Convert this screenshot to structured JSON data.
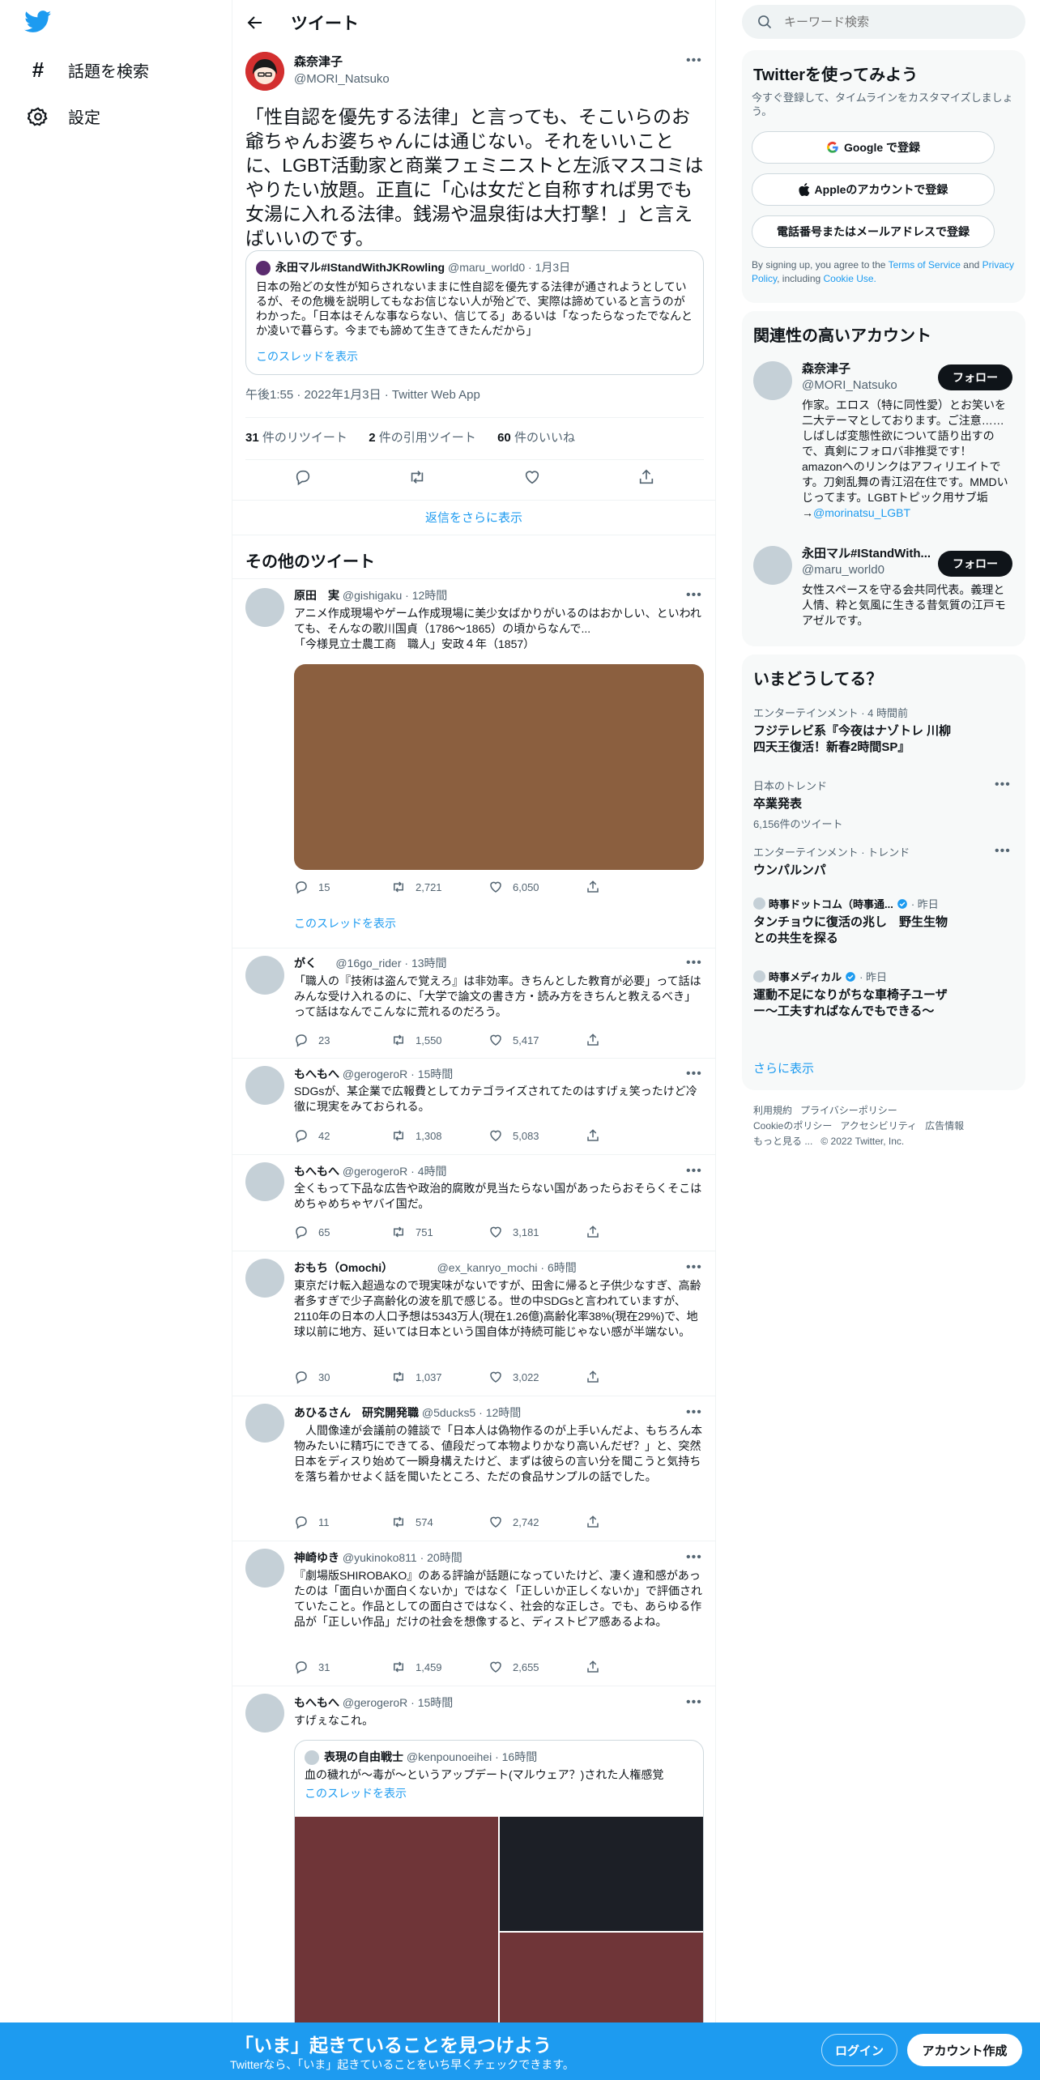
{
  "nav": {
    "explore": "話題を検索",
    "settings": "設定"
  },
  "header": {
    "title": "ツイート"
  },
  "main_tweet": {
    "name": "森奈津子",
    "handle": "@MORI_Natsuko",
    "text": "「性自認を優先する法律」と言っても、そこいらのお爺ちゃんお婆ちゃんには通じない。それをいいことに、LGBT活動家と商業フェミニストと左派マスコミはやりたい放題。正直に「心は女だと自称すれば男でも女湯に入れる法律。銭湯や温泉街は大打撃！」と言えばいいのです。",
    "quote": {
      "name": "永田マル#IStandWithJKRowling",
      "handle": "@maru_world0",
      "date": "· 1月3日",
      "text": "日本の殆どの女性が知らされないままに性自認を優先する法律が通されようとしているが、その危機を説明してもなお信じない人が殆どで、実際は諦めていると言うのがわかった。「日本はそんな事ならない、信じてる」あるいは「なったらなったでなんとか凌いで暮らす。今までも諦めて生きてきたんだから」",
      "show_thread": "このスレッドを表示"
    },
    "timestamp": "午後1:55 · 2022年1月3日 · Twitter Web App",
    "retweets_count": "31",
    "retweets_label": "件のリツイート",
    "quotes_count": "2",
    "quotes_label": "件の引用ツイート",
    "likes_count": "60",
    "likes_label": "件のいいね"
  },
  "show_more_replies": "返信をさらに表示",
  "more_tweets_title": "その他のツイート",
  "tweets": [
    {
      "name": "原田　実",
      "handle": "@gishigaku",
      "time": "· 12時間",
      "text": "アニメ作成現場やゲーム作成現場に美少女ばかりがいるのはおかしい、といわれても、そんなの歌川国貞（1786～1865）の頃からなんで...\n「今様見立士農工商　職人」安政４年（1857）",
      "replies": "15",
      "retweets": "2,721",
      "likes": "6,050",
      "show_thread": "このスレッドを表示"
    },
    {
      "name": "がく",
      "handle": "@16go_rider",
      "time": "· 13時間",
      "text": "「職人の『技術は盗んで覚えろ』は非効率。きちんとした教育が必要」って話はみんな受け入れるのに、「大学で論文の書き方・読み方をきちんと教えるべき」って話はなんでこんなに荒れるのだろう。",
      "replies": "23",
      "retweets": "1,550",
      "likes": "5,417"
    },
    {
      "name": "もへもへ",
      "handle": "@gerogeroR",
      "time": "· 15時間",
      "text": "SDGsが、某企業で広報費としてカテゴライズされてたのはすげぇ笑ったけど冷徹に現実をみておられる。",
      "replies": "42",
      "retweets": "1,308",
      "likes": "5,083"
    },
    {
      "name": "もへもへ",
      "handle": "@gerogeroR",
      "time": "· 4時間",
      "text": "全くもって下品な広告や政治的腐敗が見当たらない国があったらおそらくそこはめちゃめちゃヤバイ国だ。",
      "replies": "65",
      "retweets": "751",
      "likes": "3,181"
    },
    {
      "name": "おもち（Omochi）",
      "handle": "@ex_kanryo_mochi",
      "time": "· 6時間",
      "text": "東京だけ転入超過なので現実味がないですが、田舎に帰ると子供少なすぎ、高齢者多すぎで少子高齢化の波を肌で感じる。世の中SDGsと言われていますが、2110年の日本の人口予想は5343万人(現在1.26億)高齢化率38%(現在29%)で、地球以前に地方、延いては日本という国自体が持続可能じゃない感が半端ない。",
      "replies": "30",
      "retweets": "1,037",
      "likes": "3,022"
    },
    {
      "name": "あひるさん　研究開発職",
      "handle": "@5ducks5",
      "time": "· 12時間",
      "text": "　人間像達が会議前の雑談で「日本人は偽物作るのが上手いんだよ、もちろん本物みたいに精巧にできてる、値段だって本物よりかなり高いんだぜ？」と、突然日本をディスり始めて一瞬身構えたけど、まずは彼らの言い分を聞こうと気持ちを落ち着かせよく話を聞いたところ、ただの食品サンプルの話でした。",
      "replies": "11",
      "retweets": "574",
      "likes": "2,742"
    },
    {
      "name": "神崎ゆき",
      "handle": "@yukinoko811",
      "time": "· 20時間",
      "text": "『劇場版SHIROBAKO』のある評論が話題になっていたけど、凄く違和感があったのは「面白いか面白くないか」ではなく「正しいか正しくないか」で評価されていたこと。作品としての面白さではなく、社会的な正しさ。でも、あらゆる作品が「正しい作品」だけの社会を想像すると、ディストピア感あるよね。",
      "replies": "31",
      "retweets": "1,459",
      "likes": "2,655"
    },
    {
      "name": "もへもへ",
      "handle": "@gerogeroR",
      "time": "· 15時間",
      "text": "すげぇなこれ。",
      "quote": {
        "name": "表現の自由戦士",
        "handle": "@kenpounoeihei",
        "time": "· 16時間",
        "text": "血の穢れが〜毒が〜というアップデート(マルウェア？)された人権感覚",
        "show_thread": "このスレッドを表示"
      }
    }
  ],
  "right": {
    "search_placeholder": "キーワード検索",
    "signup": {
      "title": "Twitterを使ってみよう",
      "subtitle": "今すぐ登録して、タイムラインをカスタマイズしましょう。",
      "google": "Google で登録",
      "apple": "Appleのアカウントで登録",
      "phone": "電話番号またはメールアドレスで登録",
      "terms_prefix": "By signing up, you agree to the",
      "terms_link": "Terms of Service",
      "and": "and",
      "privacy_link": "Privacy Policy",
      "including": ", including",
      "cookie_link": "Cookie Use."
    },
    "relevant": {
      "title": "関連性の高いアカウント",
      "follow_label": "フォロー",
      "accounts": [
        {
          "name": "森奈津子",
          "handle": "@MORI_Natsuko",
          "bio": "作家。エロス（特に同性愛）とお笑いを二大テーマとしております。ご注意……しばしば変態性欲について語り出すので、真剣にフォロバ非推奨です！ amazonへのリンクはアフィリエイトです。刀剣乱舞の青江沼在住です。MMDいじってます。LGBTトピック用サブ垢→",
          "bio_link": "@morinatsu_LGBT"
        },
        {
          "name": "永田マル#IStandWith...",
          "handle": "@maru_world0",
          "bio": "女性スペースを守る会共同代表。義理と人情、粋と気風に生きる昔気質の江戸モアゼルです。"
        }
      ]
    },
    "trends": {
      "title": "いまどうしてる？",
      "items": [
        {
          "category": "エンターテインメント · 4 時間前",
          "title": "フジテレビ系『今夜はナゾトレ 川柳四天王復活！新春2時間SP』"
        },
        {
          "category": "日本のトレンド",
          "title": "卒業発表",
          "count": "6,156件のツイート"
        },
        {
          "category": "エンターテインメント · トレンド",
          "title": "ウンパルンパ"
        },
        {
          "source": "時事ドットコム（時事通...",
          "when": "· 昨日",
          "title": "タンチョウに復活の兆し　野生生物との共生を探る"
        },
        {
          "source": "時事メディカル",
          "when": "· 昨日",
          "title": "運動不足になりがちな車椅子ユーザー～工夫すればなんでもできる～"
        }
      ],
      "show_more": "さらに表示"
    },
    "footer": {
      "line1": [
        "利用規約",
        "プライバシーポリシー"
      ],
      "line2": [
        "Cookieのポリシー",
        "アクセシビリティ",
        "広告情報"
      ],
      "line3": [
        "もっと見る ...",
        "© 2022 Twitter, Inc."
      ]
    }
  },
  "bottom_bar": {
    "title": "「いま」起きていることを見つけよう",
    "subtitle": "Twitterなら、「いま」起きていることをいち早くチェックできます。",
    "login": "ログイン",
    "signup": "アカウント作成"
  },
  "colors": {
    "accent": "#1d9bf0",
    "text": "#0f1419",
    "secondary": "#536471",
    "border": "#eff3f4",
    "image_brown": "#8b5f3f",
    "image_maroon": "#6f3538",
    "image_dark": "#1c1f26"
  }
}
